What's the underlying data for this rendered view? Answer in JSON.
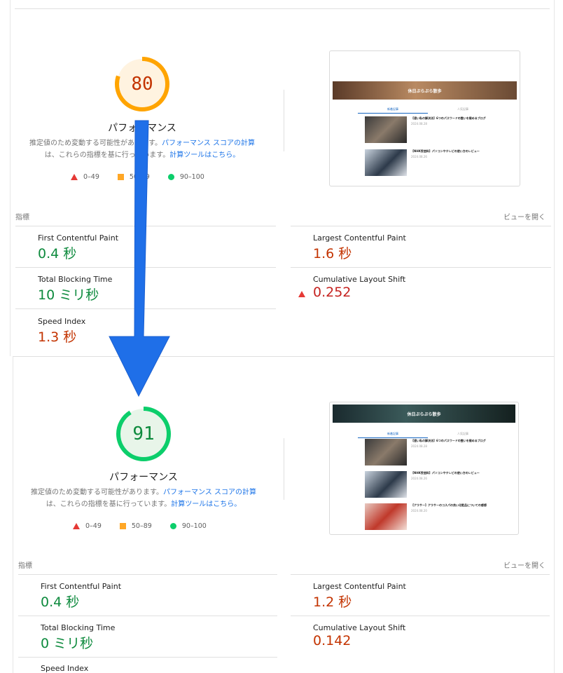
{
  "reports": [
    {
      "score": "80",
      "score_value": 80,
      "gauge_color": "#ffa400",
      "gauge_bg": "#fff3e0",
      "gauge_text_color": "#c33300",
      "gauge_title": "パフォーマンス",
      "desc_text1": "推定値のため変動する可能性があります。",
      "desc_link1": "パフォーマンス スコアの計算",
      "desc_text2": "は、これらの指標を基に行っています。",
      "desc_link2": "計算ツールはこちら。",
      "legend": {
        "poor": "0–49",
        "average": "50–89",
        "good": "90–100"
      },
      "metrics_label": "指標",
      "view_toggle": "ビューを開く",
      "thumbnail": {
        "site_title": "休日ぶらぶら散歩",
        "tabs": [
          "新着記事",
          "人気記事"
        ],
        "banner_color": "#8a5a3c"
      },
      "metrics": [
        {
          "name": "First Contentful Paint",
          "value": "0.4 秒",
          "status": "good"
        },
        {
          "name": "Largest Contentful Paint",
          "value": "1.6 秒",
          "status": "average"
        },
        {
          "name": "Total Blocking Time",
          "value": "10 ミリ秒",
          "status": "good"
        },
        {
          "name": "Cumulative Layout Shift",
          "value": "0.252",
          "status": "poor"
        },
        {
          "name": "Speed Index",
          "value": "1.3 秒",
          "status": "average"
        }
      ]
    },
    {
      "score": "91",
      "score_value": 91,
      "gauge_color": "#0cce6b",
      "gauge_bg": "#e8f5e9",
      "gauge_text_color": "#0d8a3d",
      "gauge_title": "パフォーマンス",
      "desc_text1": "推定値のため変動する可能性があります。",
      "desc_link1": "パフォーマンス スコアの計算",
      "desc_text2": "は、これらの指標を基に行っています。",
      "desc_link2": "計算ツールはこちら。",
      "legend": {
        "poor": "0–49",
        "average": "50–89",
        "good": "90–100"
      },
      "metrics_label": "指標",
      "view_toggle": "ビューを開く",
      "thumbnail": {
        "site_title": "休日ぶらぶら散歩",
        "tabs": [
          "新着記事",
          "人気記事"
        ],
        "banner_color": "#1e2f33"
      },
      "metrics": [
        {
          "name": "First Contentful Paint",
          "value": "0.4 秒",
          "status": "good"
        },
        {
          "name": "Largest Contentful Paint",
          "value": "1.2 秒",
          "status": "average"
        },
        {
          "name": "Total Blocking Time",
          "value": "0 ミリ秒",
          "status": "good"
        },
        {
          "name": "Cumulative Layout Shift",
          "value": "0.142",
          "status": "average"
        },
        {
          "name": "Speed Index",
          "value": "",
          "status": "good"
        }
      ]
    }
  ],
  "arrow_color": "#1f6fe8"
}
